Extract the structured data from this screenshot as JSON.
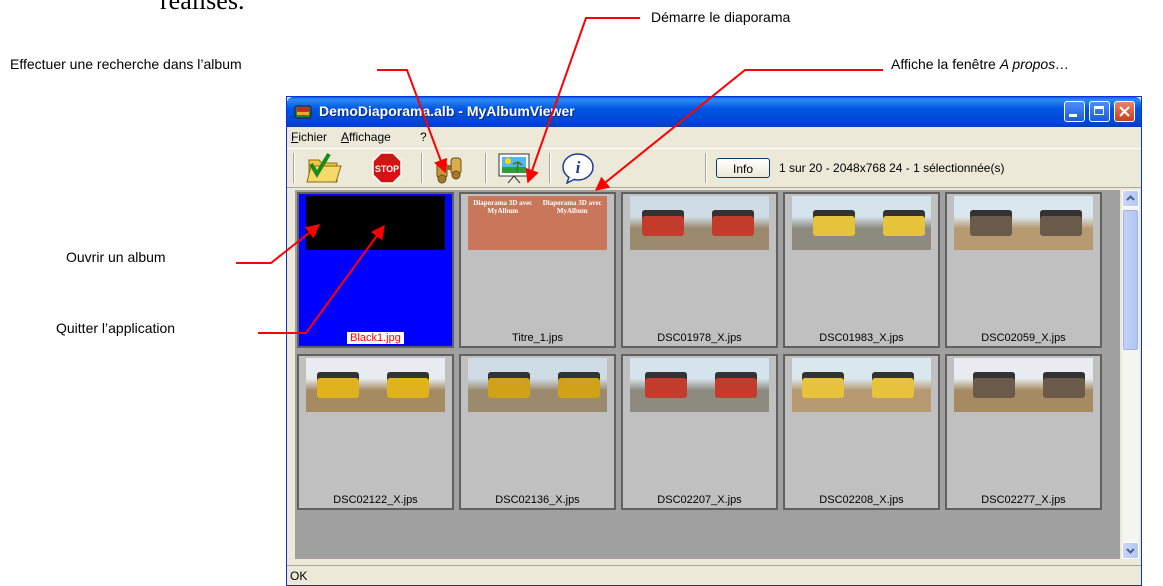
{
  "document": {
    "fragment": "réalisés."
  },
  "annotations": {
    "search": "Effectuer une recherche dans l’album",
    "slideshow": "Démarre le diaporama",
    "about_prefix": "Affiche la fenêtre ",
    "about_italic": "A propos…",
    "open": "Ouvrir un album",
    "quit": "Quitter l’application"
  },
  "window": {
    "title": "DemoDiaporama.alb - MyAlbumViewer"
  },
  "menu": [
    {
      "label": "Fichier",
      "accel": "F",
      "rest": "ichier"
    },
    {
      "label": "Affichage",
      "accel": "A",
      "rest": "ffichage"
    },
    {
      "label": "?"
    }
  ],
  "toolbar": {
    "buttons": [
      {
        "name": "open-album",
        "icon": "folder-check-icon"
      },
      {
        "name": "stop",
        "icon": "stop-sign-icon",
        "text": "STOP"
      },
      {
        "name": "search",
        "icon": "binoculars-icon"
      },
      {
        "name": "slideshow",
        "icon": "projection-screen-icon"
      },
      {
        "name": "about",
        "icon": "info-icon",
        "text": "i"
      }
    ],
    "info_label": "Info",
    "status": "1 sur 20 - 2048x768 24 - 1 sélectionnée(s)"
  },
  "thumbnails": [
    {
      "file": "Black1.jpg",
      "selected": true,
      "kind": "black"
    },
    {
      "file": "Titre_1.jps",
      "selected": false,
      "kind": "title",
      "title_text": "Diaporama 3D avec MyAlbum"
    },
    {
      "file": "DSC01978_X.jps",
      "selected": false,
      "kind": "photo"
    },
    {
      "file": "DSC01983_X.jps",
      "selected": false,
      "kind": "photo"
    },
    {
      "file": "DSC02059_X.jps",
      "selected": false,
      "kind": "photo"
    },
    {
      "file": "DSC02122_X.jps",
      "selected": false,
      "kind": "photo"
    },
    {
      "file": "DSC02136_X.jps",
      "selected": false,
      "kind": "photo"
    },
    {
      "file": "DSC02207_X.jps",
      "selected": false,
      "kind": "photo"
    },
    {
      "file": "DSC02208_X.jps",
      "selected": false,
      "kind": "photo"
    },
    {
      "file": "DSC02277_X.jps",
      "selected": false,
      "kind": "photo"
    }
  ],
  "statusbar": {
    "text": "OK"
  },
  "colors": {
    "titlebar": "#0055e5",
    "selection": "#0000ff",
    "selected_label": "#ff0000",
    "callout": "#ff0000"
  }
}
